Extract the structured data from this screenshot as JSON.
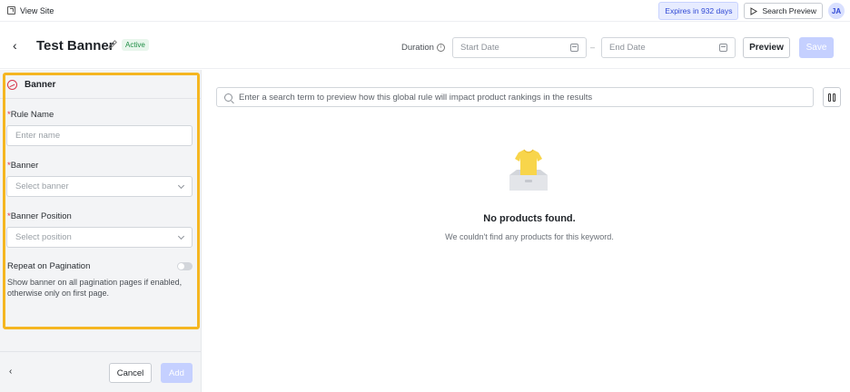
{
  "topbar": {
    "view_site": "View Site",
    "expires": "Expires in 932 days",
    "search_preview": "Search Preview",
    "avatar": "JA"
  },
  "header": {
    "title": "Test Banner",
    "status": "Active",
    "duration_label": "Duration",
    "start_date_placeholder": "Start Date",
    "date_separator": "–",
    "end_date_placeholder": "End Date",
    "preview_label": "Preview",
    "save_label": "Save"
  },
  "panel": {
    "title": "Banner",
    "rule_name_label": "Rule Name",
    "rule_name_placeholder": "Enter name",
    "banner_label": "Banner",
    "banner_placeholder": "Select banner",
    "position_label": "Banner Position",
    "position_placeholder": "Select position",
    "repeat_label": "Repeat on Pagination",
    "repeat_enabled": false,
    "repeat_help": "Show banner on all pagination pages if enabled, otherwise only on first page.",
    "required_marker": "*",
    "back_symbol": "‹",
    "cancel_label": "Cancel",
    "add_label": "Add"
  },
  "main": {
    "search_placeholder": "Enter a search term to preview how this global rule will impact product rankings in the results",
    "empty_title": "No products found.",
    "empty_subtitle": "We couldn't find any products for this keyword."
  },
  "colors": {
    "accent": "#2f48d4",
    "highlight": "#f5b621",
    "required": "#d8344a",
    "active": "#1f8d45",
    "disabled_button": "#c5d0ff"
  },
  "icons": {
    "back": "back-arrow-icon",
    "edit": "pencil-icon",
    "info": "info-circle-icon",
    "calendar": "calendar-icon",
    "banner": "banner-icon",
    "chevron": "chevron-down-icon",
    "search": "search-icon",
    "columns": "columns-icon"
  }
}
